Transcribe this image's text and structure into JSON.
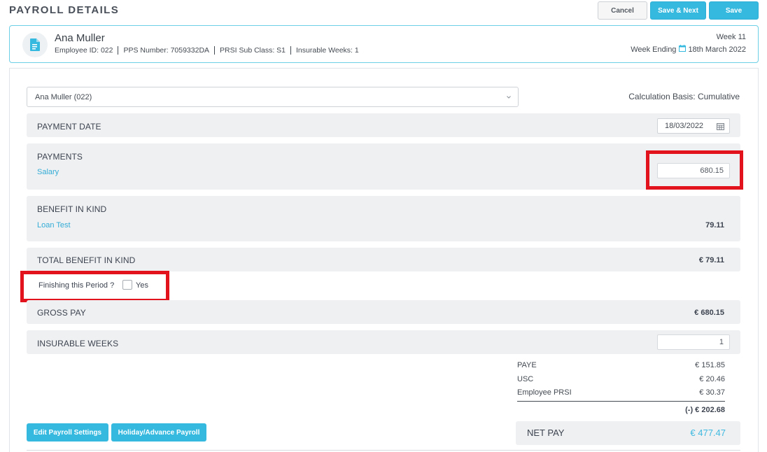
{
  "header": {
    "title": "PAYROLL DETAILS",
    "cancel_label": "Cancel",
    "save_next_label": "Save & Next",
    "save_label": "Save"
  },
  "employee": {
    "name": "Ana Muller",
    "employee_id": "Employee ID: 022",
    "pps_number": "PPS Number: 7059332DA",
    "prsi_sub_class": "PRSI Sub Class: S1",
    "insurable_weeks": "Insurable Weeks: 1",
    "week": "Week 11",
    "week_ending_label": "Week Ending",
    "week_ending_date": "18th March 2022"
  },
  "form": {
    "selected_employee": "Ana Muller (022)",
    "calculation_basis": "Calculation Basis: Cumulative",
    "payment_date_label": "PAYMENT DATE",
    "payment_date": "18/03/2022",
    "payments_label": "PAYMENTS",
    "salary_label": "Salary",
    "salary_value": "680.15",
    "bik_label": "BENEFIT IN KIND",
    "bik_item_label": "Loan Test",
    "bik_item_value": "79.11",
    "total_bik_label": "TOTAL BENEFIT IN KIND",
    "total_bik_value": "€ 79.11",
    "finishing_label": "Finishing this Period ?",
    "finishing_yes": "Yes",
    "gross_pay_label": "GROSS PAY",
    "gross_pay_value": "€ 680.15",
    "insurable_weeks_label": "INSURABLE WEEKS",
    "insurable_weeks_value": "1"
  },
  "deductions": [
    {
      "label": "PAYE",
      "value": "€ 151.85"
    },
    {
      "label": "USC",
      "value": "€ 20.46"
    },
    {
      "label": "Employee PRSI",
      "value": "€ 30.37"
    }
  ],
  "deductions_total": "(-)  € 202.68",
  "footer": {
    "edit_settings_label": "Edit Payroll Settings",
    "holiday_label": "Holiday/Advance Payroll",
    "net_pay_label": "NET PAY",
    "net_pay_value": "€ 477.47"
  },
  "colors": {
    "accent": "#35b9df",
    "highlight": "#e2131c",
    "section_bg": "#eff0f2"
  },
  "icons": [
    "document-icon",
    "calendar-icon",
    "chevron-down-icon"
  ]
}
